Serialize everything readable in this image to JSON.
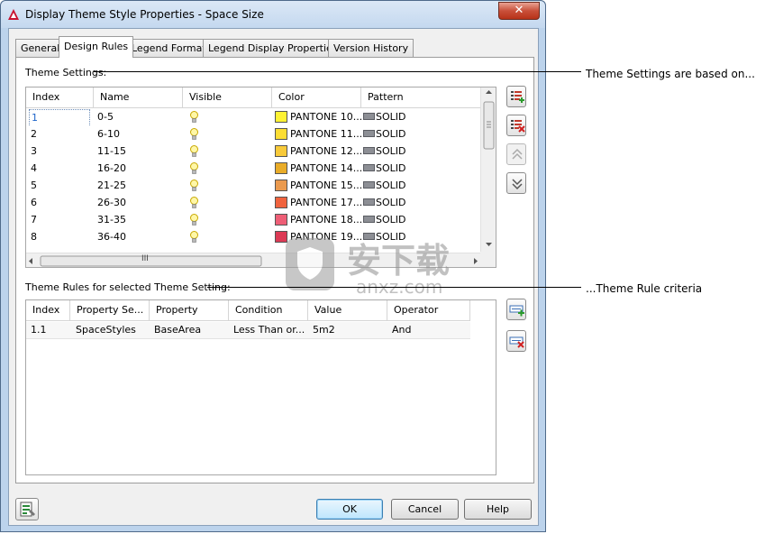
{
  "window": {
    "title": "Display Theme Style Properties - Space Size",
    "close_glyph": "✕"
  },
  "tabs": [
    {
      "label": "General",
      "active": false
    },
    {
      "label": "Design Rules",
      "active": true
    },
    {
      "label": "Legend Format",
      "active": false
    },
    {
      "label": "Legend Display Properties",
      "active": false
    },
    {
      "label": "Version History",
      "active": false
    }
  ],
  "theme_settings": {
    "label": "Theme Settings:",
    "columns": [
      "Index",
      "Name",
      "Visible",
      "Color",
      "Pattern"
    ],
    "rows": [
      {
        "index": "1",
        "name": "0-5",
        "color_hex": "#fef234",
        "color_text": "PANTONE 10...",
        "pattern": "SOLID"
      },
      {
        "index": "2",
        "name": "6-10",
        "color_hex": "#fdde34",
        "color_text": "PANTONE 11...",
        "pattern": "SOLID"
      },
      {
        "index": "3",
        "name": "11-15",
        "color_hex": "#f8ca3a",
        "color_text": "PANTONE 12...",
        "pattern": "SOLID"
      },
      {
        "index": "4",
        "name": "16-20",
        "color_hex": "#e9ac28",
        "color_text": "PANTONE 14...",
        "pattern": "SOLID"
      },
      {
        "index": "5",
        "name": "21-25",
        "color_hex": "#eb9a4e",
        "color_text": "PANTONE 15...",
        "pattern": "SOLID"
      },
      {
        "index": "6",
        "name": "26-30",
        "color_hex": "#f0633e",
        "color_text": "PANTONE 17...",
        "pattern": "SOLID"
      },
      {
        "index": "7",
        "name": "31-35",
        "color_hex": "#ee5e76",
        "color_text": "PANTONE 18...",
        "pattern": "SOLID"
      },
      {
        "index": "8",
        "name": "36-40",
        "color_hex": "#dc3a55",
        "color_text": "PANTONE 19...",
        "pattern": "SOLID"
      }
    ],
    "hscroll_thumb_glyph": "III"
  },
  "theme_rules": {
    "label": "Theme Rules for selected Theme Setting:",
    "columns": [
      "Index",
      "Property Se...",
      "Property",
      "Condition",
      "Value",
      "Operator"
    ],
    "rows": [
      {
        "index": "1.1",
        "property_set": "SpaceStyles",
        "property": "BaseArea",
        "condition": "Less Than or...",
        "value": "5m2",
        "operator": "And"
      }
    ]
  },
  "buttons": {
    "ok": "OK",
    "cancel": "Cancel",
    "help": "Help"
  },
  "callouts": {
    "settings": "Theme Settings are based on...",
    "rules": "...Theme Rule criteria"
  },
  "watermark": {
    "text": "安下载",
    "subtext": "anxz.com"
  },
  "colors": {
    "title_bar": "#c4d8ef",
    "close_button": "#c9503a",
    "selection_text": "#1c63c9"
  },
  "icons": {
    "app": "autocad-logo-icon",
    "visible": "lightbulb-icon",
    "add_setting": "add-theme-setting-icon",
    "remove_setting": "remove-theme-setting-icon",
    "move_up": "move-up-icon",
    "move_down": "move-down-icon",
    "add_rule": "add-rule-icon",
    "remove_rule": "remove-rule-icon",
    "style_editor": "style-editor-icon"
  }
}
